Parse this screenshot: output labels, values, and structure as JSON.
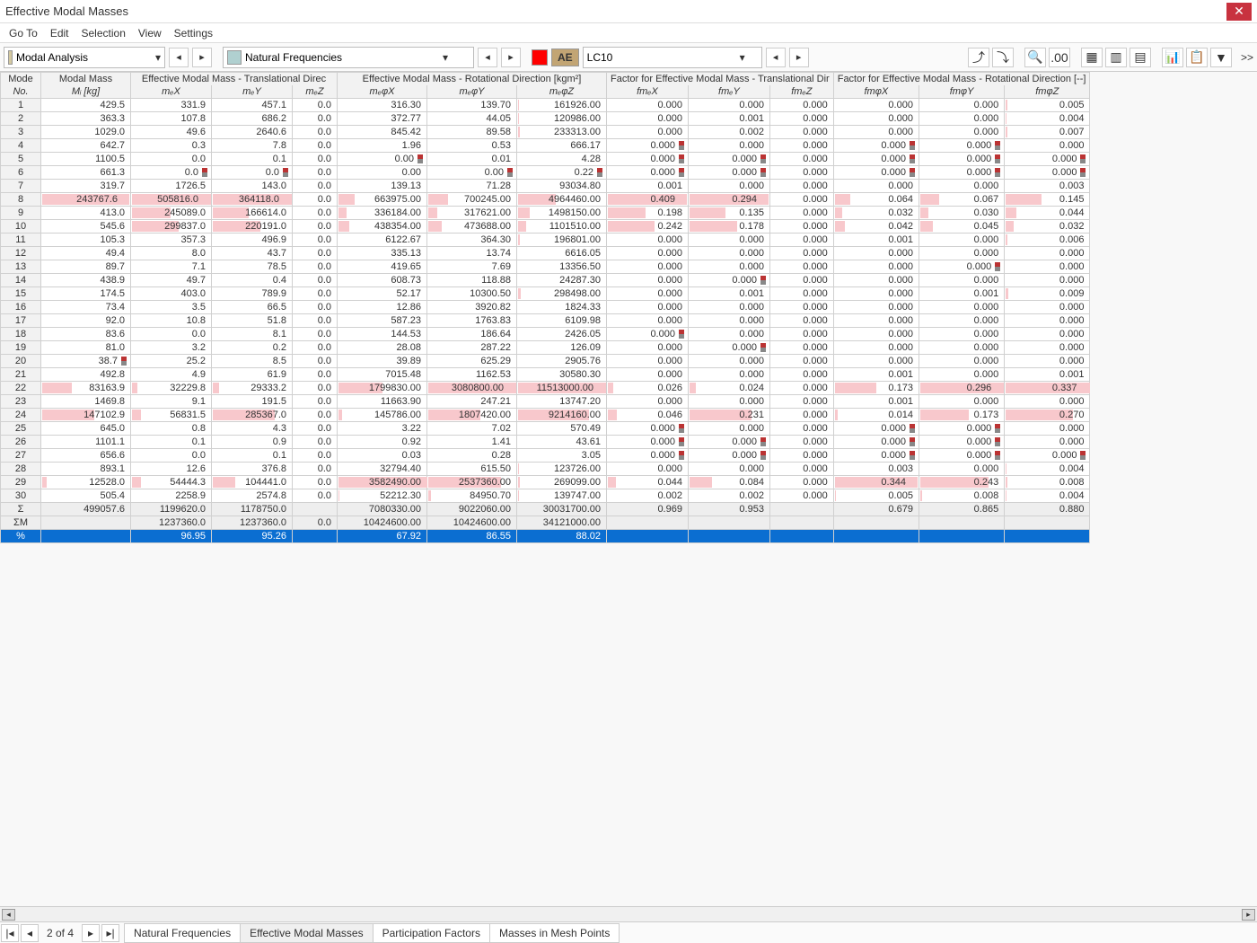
{
  "window": {
    "title": "Effective Modal Masses"
  },
  "menu": [
    "Go To",
    "Edit",
    "Selection",
    "View",
    "Settings"
  ],
  "toolbar": {
    "combo1": "Modal Analysis",
    "combo2": "Natural Frequencies",
    "tag": "AE",
    "lc": "LC10",
    "more": ">>"
  },
  "columns": {
    "groups": [
      {
        "label": "Mode",
        "span": 1
      },
      {
        "label": "Modal Mass",
        "span": 1
      },
      {
        "label": "Effective Modal Mass - Translational Direc",
        "span": 3
      },
      {
        "label": "Effective Modal Mass - Rotational Direction [kgm²]",
        "span": 3
      },
      {
        "label": "Factor for Effective Modal Mass - Translational Dir",
        "span": 3
      },
      {
        "label": "Factor for Effective Modal Mass - Rotational Direction [--]",
        "span": 3
      }
    ],
    "subs": [
      "No.",
      "Mᵢ [kg]",
      "mₑX",
      "mₑY",
      "mₑZ",
      "mₑφX",
      "mₑφY",
      "mₑφZ",
      "fmₑX",
      "fmₑY",
      "fmₑZ",
      "fmφX",
      "fmφY",
      "fmφZ"
    ]
  },
  "scales": [
    250000,
    510000,
    370000,
    1,
    3600000,
    3100000,
    11600000,
    0.42,
    0.3,
    1,
    0.35,
    0.3,
    0.34
  ],
  "rows": [
    {
      "n": "1",
      "v": [
        "429.5",
        "331.9",
        "457.1",
        "0.0",
        "316.30",
        "139.70",
        "161926.00",
        "0.000",
        "0.000",
        "0.000",
        "0.000",
        "0.000",
        "0.005"
      ]
    },
    {
      "n": "2",
      "v": [
        "363.3",
        "107.8",
        "686.2",
        "0.0",
        "372.77",
        "44.05",
        "120986.00",
        "0.000",
        "0.001",
        "0.000",
        "0.000",
        "0.000",
        "0.004"
      ]
    },
    {
      "n": "3",
      "v": [
        "1029.0",
        "49.6",
        "2640.6",
        "0.0",
        "845.42",
        "89.58",
        "233313.00",
        "0.000",
        "0.002",
        "0.000",
        "0.000",
        "0.000",
        "0.007"
      ]
    },
    {
      "n": "4",
      "v": [
        "642.7",
        "0.3",
        "7.8",
        "0.0",
        "1.96",
        "0.53",
        "666.17",
        "0.000",
        "0.000",
        "0.000",
        "0.000",
        "0.000",
        "0.000"
      ],
      "f": [
        0,
        0,
        0,
        0,
        0,
        0,
        0,
        1,
        0,
        0,
        1,
        1,
        0
      ]
    },
    {
      "n": "5",
      "v": [
        "1100.5",
        "0.0",
        "0.1",
        "0.0",
        "0.00",
        "0.01",
        "4.28",
        "0.000",
        "0.000",
        "0.000",
        "0.000",
        "0.000",
        "0.000"
      ],
      "f": [
        0,
        0,
        0,
        0,
        1,
        0,
        0,
        1,
        1,
        0,
        1,
        1,
        1
      ]
    },
    {
      "n": "6",
      "v": [
        "661.3",
        "0.0",
        "0.0",
        "0.0",
        "0.00",
        "0.00",
        "0.22",
        "0.000",
        "0.000",
        "0.000",
        "0.000",
        "0.000",
        "0.000"
      ],
      "f": [
        0,
        1,
        1,
        0,
        0,
        1,
        1,
        1,
        1,
        0,
        1,
        1,
        1
      ]
    },
    {
      "n": "7",
      "v": [
        "319.7",
        "1726.5",
        "143.0",
        "0.0",
        "139.13",
        "71.28",
        "93034.80",
        "0.001",
        "0.000",
        "0.000",
        "0.000",
        "0.000",
        "0.003"
      ]
    },
    {
      "n": "8",
      "v": [
        "243767.6",
        "505816.0",
        "364118.0",
        "0.0",
        "663975.00",
        "700245.00",
        "4964460.00",
        "0.409",
        "0.294",
        "0.000",
        "0.064",
        "0.067",
        "0.145"
      ],
      "f": [
        1,
        1,
        1,
        0,
        0,
        0,
        0,
        1,
        1,
        0,
        0,
        0,
        0
      ]
    },
    {
      "n": "9",
      "v": [
        "413.0",
        "245089.0",
        "166614.0",
        "0.0",
        "336184.00",
        "317621.00",
        "1498150.00",
        "0.198",
        "0.135",
        "0.000",
        "0.032",
        "0.030",
        "0.044"
      ]
    },
    {
      "n": "10",
      "v": [
        "545.6",
        "299837.0",
        "220191.0",
        "0.0",
        "438354.00",
        "473688.00",
        "1101510.00",
        "0.242",
        "0.178",
        "0.000",
        "0.042",
        "0.045",
        "0.032"
      ]
    },
    {
      "n": "11",
      "v": [
        "105.3",
        "357.3",
        "496.9",
        "0.0",
        "6122.67",
        "364.30",
        "196801.00",
        "0.000",
        "0.000",
        "0.000",
        "0.001",
        "0.000",
        "0.006"
      ]
    },
    {
      "n": "12",
      "v": [
        "49.4",
        "8.0",
        "43.7",
        "0.0",
        "335.13",
        "13.74",
        "6616.05",
        "0.000",
        "0.000",
        "0.000",
        "0.000",
        "0.000",
        "0.000"
      ]
    },
    {
      "n": "13",
      "v": [
        "89.7",
        "7.1",
        "78.5",
        "0.0",
        "419.65",
        "7.69",
        "13356.50",
        "0.000",
        "0.000",
        "0.000",
        "0.000",
        "0.000",
        "0.000"
      ],
      "f": [
        0,
        0,
        0,
        0,
        0,
        0,
        0,
        0,
        0,
        0,
        0,
        1,
        0
      ]
    },
    {
      "n": "14",
      "v": [
        "438.9",
        "49.7",
        "0.4",
        "0.0",
        "608.73",
        "118.88",
        "24287.30",
        "0.000",
        "0.000",
        "0.000",
        "0.000",
        "0.000",
        "0.000"
      ],
      "f": [
        0,
        0,
        0,
        0,
        0,
        0,
        0,
        0,
        1,
        0,
        0,
        0,
        0
      ]
    },
    {
      "n": "15",
      "v": [
        "174.5",
        "403.0",
        "789.9",
        "0.0",
        "52.17",
        "10300.50",
        "298498.00",
        "0.000",
        "0.001",
        "0.000",
        "0.000",
        "0.001",
        "0.009"
      ]
    },
    {
      "n": "16",
      "v": [
        "73.4",
        "3.5",
        "66.5",
        "0.0",
        "12.86",
        "3920.82",
        "1824.33",
        "0.000",
        "0.000",
        "0.000",
        "0.000",
        "0.000",
        "0.000"
      ]
    },
    {
      "n": "17",
      "v": [
        "92.0",
        "10.8",
        "51.8",
        "0.0",
        "587.23",
        "1763.83",
        "6109.98",
        "0.000",
        "0.000",
        "0.000",
        "0.000",
        "0.000",
        "0.000"
      ]
    },
    {
      "n": "18",
      "v": [
        "83.6",
        "0.0",
        "8.1",
        "0.0",
        "144.53",
        "186.64",
        "2426.05",
        "0.000",
        "0.000",
        "0.000",
        "0.000",
        "0.000",
        "0.000"
      ],
      "f": [
        0,
        0,
        0,
        0,
        0,
        0,
        0,
        1,
        0,
        0,
        0,
        0,
        0
      ]
    },
    {
      "n": "19",
      "v": [
        "81.0",
        "3.2",
        "0.2",
        "0.0",
        "28.08",
        "287.22",
        "126.09",
        "0.000",
        "0.000",
        "0.000",
        "0.000",
        "0.000",
        "0.000"
      ],
      "f": [
        0,
        0,
        0,
        0,
        0,
        0,
        0,
        0,
        1,
        0,
        0,
        0,
        0
      ]
    },
    {
      "n": "20",
      "v": [
        "38.7",
        "25.2",
        "8.5",
        "0.0",
        "39.89",
        "625.29",
        "2905.76",
        "0.000",
        "0.000",
        "0.000",
        "0.000",
        "0.000",
        "0.000"
      ],
      "f": [
        1,
        0,
        0,
        0,
        0,
        0,
        0,
        0,
        0,
        0,
        0,
        0,
        0
      ]
    },
    {
      "n": "21",
      "v": [
        "492.8",
        "4.9",
        "61.9",
        "0.0",
        "7015.48",
        "1162.53",
        "30580.30",
        "0.000",
        "0.000",
        "0.000",
        "0.001",
        "0.000",
        "0.001"
      ]
    },
    {
      "n": "22",
      "v": [
        "83163.9",
        "32229.8",
        "29333.2",
        "0.0",
        "1799830.00",
        "3080800.00",
        "11513000.00",
        "0.026",
        "0.024",
        "0.000",
        "0.173",
        "0.296",
        "0.337"
      ],
      "f": [
        0,
        0,
        0,
        0,
        0,
        1,
        1,
        0,
        0,
        0,
        0,
        1,
        1
      ]
    },
    {
      "n": "23",
      "v": [
        "1469.8",
        "9.1",
        "191.5",
        "0.0",
        "11663.90",
        "247.21",
        "13747.20",
        "0.000",
        "0.000",
        "0.000",
        "0.001",
        "0.000",
        "0.000"
      ]
    },
    {
      "n": "24",
      "v": [
        "147102.9",
        "56831.5",
        "285367.0",
        "0.0",
        "145786.00",
        "1807420.00",
        "9214160.00",
        "0.046",
        "0.231",
        "0.000",
        "0.014",
        "0.173",
        "0.270"
      ]
    },
    {
      "n": "25",
      "v": [
        "645.0",
        "0.8",
        "4.3",
        "0.0",
        "3.22",
        "7.02",
        "570.49",
        "0.000",
        "0.000",
        "0.000",
        "0.000",
        "0.000",
        "0.000"
      ],
      "f": [
        0,
        0,
        0,
        0,
        0,
        0,
        0,
        1,
        0,
        0,
        1,
        1,
        0
      ]
    },
    {
      "n": "26",
      "v": [
        "1101.1",
        "0.1",
        "0.9",
        "0.0",
        "0.92",
        "1.41",
        "43.61",
        "0.000",
        "0.000",
        "0.000",
        "0.000",
        "0.000",
        "0.000"
      ],
      "f": [
        0,
        0,
        0,
        0,
        0,
        0,
        0,
        1,
        1,
        0,
        1,
        1,
        0
      ]
    },
    {
      "n": "27",
      "v": [
        "656.6",
        "0.0",
        "0.1",
        "0.0",
        "0.03",
        "0.28",
        "3.05",
        "0.000",
        "0.000",
        "0.000",
        "0.000",
        "0.000",
        "0.000"
      ],
      "f": [
        0,
        0,
        0,
        0,
        0,
        0,
        0,
        1,
        1,
        0,
        1,
        1,
        1
      ]
    },
    {
      "n": "28",
      "v": [
        "893.1",
        "12.6",
        "376.8",
        "0.0",
        "32794.40",
        "615.50",
        "123726.00",
        "0.000",
        "0.000",
        "0.000",
        "0.003",
        "0.000",
        "0.004"
      ]
    },
    {
      "n": "29",
      "v": [
        "12528.0",
        "54444.3",
        "104441.0",
        "0.0",
        "3582490.00",
        "2537360.00",
        "269099.00",
        "0.044",
        "0.084",
        "0.000",
        "0.344",
        "0.243",
        "0.008"
      ],
      "f": [
        0,
        0,
        0,
        0,
        0,
        0,
        0,
        0,
        0,
        0,
        1,
        0,
        0
      ]
    },
    {
      "n": "30",
      "v": [
        "505.4",
        "2258.9",
        "2574.8",
        "0.0",
        "52212.30",
        "84950.70",
        "139747.00",
        "0.002",
        "0.002",
        "0.000",
        "0.005",
        "0.008",
        "0.004"
      ]
    }
  ],
  "summary": [
    {
      "n": "Σ",
      "v": [
        "499057.6",
        "1199620.0",
        "1178750.0",
        "",
        "7080330.00",
        "9022060.00",
        "30031700.00",
        "0.969",
        "0.953",
        "",
        "0.679",
        "0.865",
        "0.880"
      ]
    },
    {
      "n": "ΣM",
      "v": [
        "",
        "1237360.0",
        "1237360.0",
        "0.0",
        "10424600.00",
        "10424600.00",
        "34121000.00",
        "",
        "",
        "",
        "",
        "",
        ""
      ]
    },
    {
      "n": "%",
      "v": [
        "",
        "96.95",
        "95.26",
        "",
        "67.92",
        "86.55",
        "88.02",
        "",
        "",
        "",
        "",
        "",
        ""
      ]
    }
  ],
  "bottom": {
    "page": "2 of 4",
    "tabs": [
      "Natural Frequencies",
      "Effective Modal Masses",
      "Participation Factors",
      "Masses in Mesh Points"
    ],
    "active": 1
  }
}
